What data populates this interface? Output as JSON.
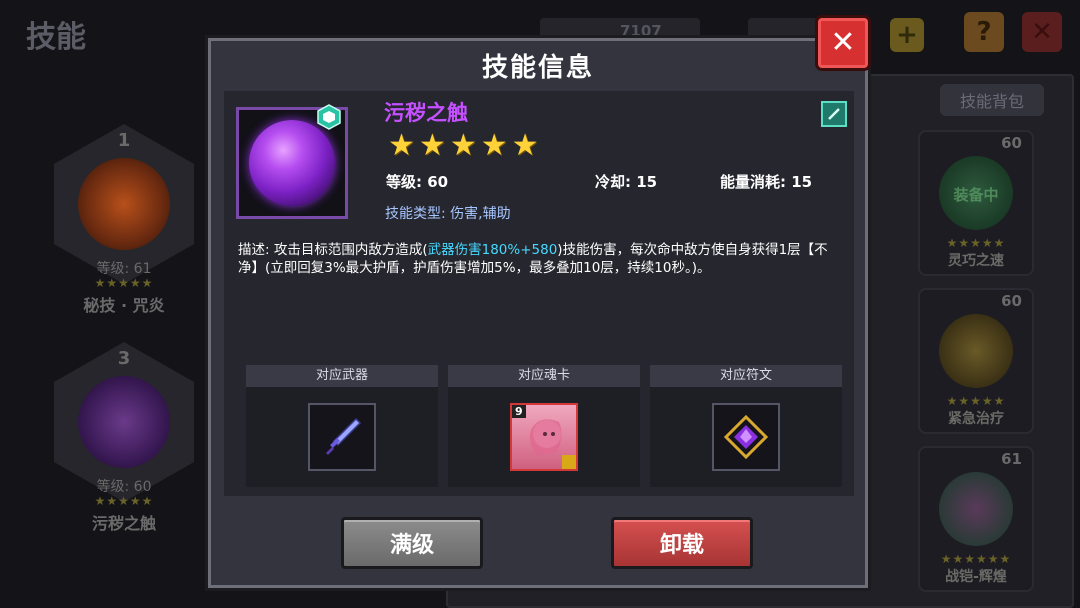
{
  "background": {
    "page_title": "技能",
    "top_value": "7107",
    "bag_tab": "技能背包",
    "slots": [
      {
        "num": "1",
        "level": "等级: 61",
        "stars": "★★★★★",
        "name": "秘技 · 咒炎"
      },
      {
        "num": "3",
        "level": "等级: 60",
        "stars": "★★★★★",
        "name": "污秽之触"
      }
    ],
    "cards": [
      {
        "num": "60",
        "equip": "装备中",
        "stars": "★★★★★",
        "name": "灵巧之速"
      },
      {
        "num": "60",
        "equip": "",
        "stars": "★★★★★",
        "name": "紧急治疗"
      },
      {
        "num": "61",
        "equip": "",
        "stars": "★★★★★★",
        "name": "战铠-辉煌"
      }
    ]
  },
  "dialog": {
    "title": "技能信息",
    "skill": {
      "name": "污秽之触",
      "star_count": 5,
      "level_label": "等级: 60",
      "cooldown_label": "冷却: 15",
      "energy_label": "能量消耗: 15",
      "type_label": "技能类型: 伤害,辅助",
      "desc_pre": "描述: 攻击目标范围内敌方造成(",
      "desc_highlight": "武器伤害180%+580",
      "desc_post": ")技能伤害，每次命中敌方使自身获得1层【不净】(立即回复3%最大护盾，护盾伤害增加5%，最多叠加10层，持续10秒。)。"
    },
    "related": {
      "weapon_label": "对应武器",
      "soulcard_label": "对应魂卡",
      "soulcard_level": "9",
      "rune_label": "对应符文"
    },
    "buttons": {
      "max_level": "满级",
      "unload": "卸载"
    }
  },
  "colors": {
    "skill_name": "#c450ff",
    "highlight": "#46d9ff",
    "star": "#ffd23a",
    "close": "#d63030"
  }
}
